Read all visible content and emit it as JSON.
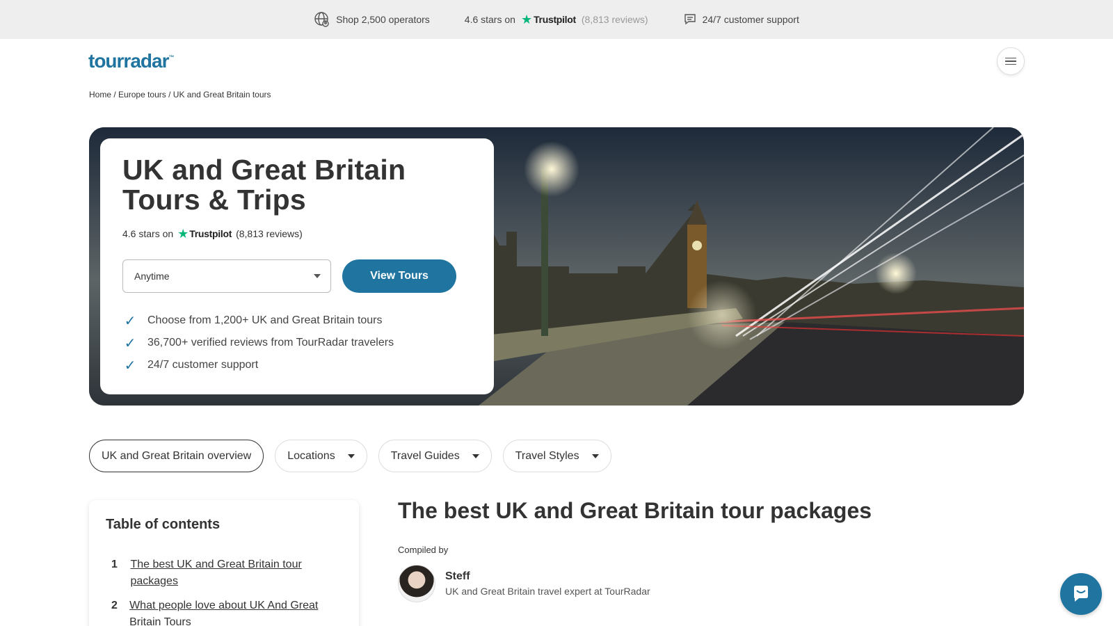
{
  "topbar": {
    "operators": "Shop 2,500 operators",
    "rating_prefix": "4.6 stars on",
    "trustpilot": "Trustpilot",
    "reviews": "(8,813 reviews)",
    "support": "24/7 customer support"
  },
  "header": {
    "logo": "tourradar",
    "logo_tm": "™"
  },
  "breadcrumb": {
    "items": [
      "Home",
      "Europe tours",
      "UK and Great Britain tours"
    ],
    "separator": "/"
  },
  "hero": {
    "title_line1": "UK and Great Britain",
    "title_line2": "Tours & Trips",
    "rating_prefix": "4.6 stars on",
    "trustpilot": "Trustpilot",
    "reviews": "(8,813 reviews)",
    "date_select": "Anytime",
    "view_button": "View Tours",
    "bullets": [
      "Choose from 1,200+ UK and Great Britain tours",
      "36,700+ verified reviews from TourRadar travelers",
      "24/7 customer support"
    ]
  },
  "chips": [
    {
      "label": "UK and Great Britain overview"
    },
    {
      "label": "Locations"
    },
    {
      "label": "Travel Guides"
    },
    {
      "label": "Travel Styles"
    }
  ],
  "toc": {
    "title": "Table of contents",
    "items": [
      {
        "num": "1",
        "label": "The best UK and Great Britain tour packages"
      },
      {
        "num": "2",
        "label": "What people love about UK And Great Britain Tours"
      }
    ]
  },
  "article": {
    "title": "The best UK and Great Britain tour packages",
    "compiled_by": "Compiled by",
    "author_name": "Steff",
    "author_role": "UK and Great Britain travel expert at TourRadar"
  },
  "colors": {
    "brand": "#1f74a0",
    "trustpilot_green": "#00b67a"
  }
}
